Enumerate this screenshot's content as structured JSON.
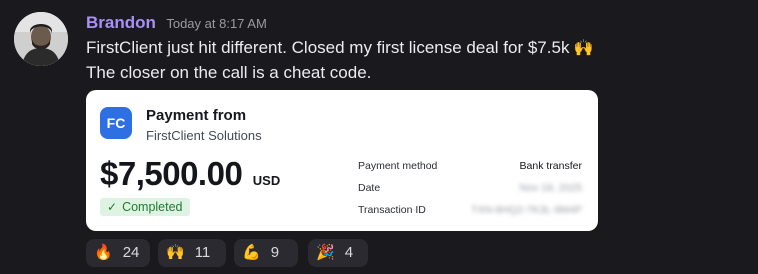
{
  "message": {
    "author": "Brandon",
    "timestamp": "Today at 8:17 AM",
    "line1": "FirstClient just hit different. Closed my first license deal for $7.5k",
    "line1_emoji": "🙌",
    "line2": "The closer on the call is a cheat code.",
    "author_color": "#a98ff7"
  },
  "payment_card": {
    "logo_text": "FC",
    "title": "Payment from",
    "payer": "FirstClient Solutions",
    "amount": "$7,500.00",
    "currency": "USD",
    "status": "Completed",
    "status_icon": "✓",
    "details": [
      {
        "label": "Payment method",
        "value": "Bank transfer"
      },
      {
        "label": "Date",
        "value": "Nov 18, 2025"
      },
      {
        "label": "Transaction ID",
        "value": "TXN-8HQ2-7K3L-9M4P"
      }
    ]
  },
  "reactions": [
    {
      "emoji": "🔥",
      "count": "24"
    },
    {
      "emoji": "🙌",
      "count": "11"
    },
    {
      "emoji": "💪",
      "count": "9"
    },
    {
      "emoji": "🎉",
      "count": "4"
    }
  ]
}
